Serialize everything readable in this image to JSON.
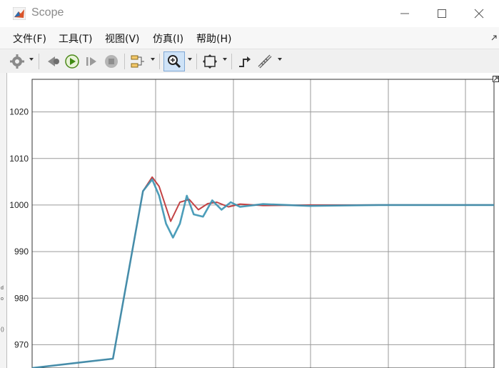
{
  "window": {
    "title": "Scope",
    "accent": "#0072bd"
  },
  "menu": {
    "items": [
      "文件(F)",
      "工具(T)",
      "视图(V)",
      "仿真(I)",
      "帮助(H)"
    ]
  },
  "toolbar": {
    "buttons": [
      "gear-icon",
      "stop-back-icon",
      "run-icon",
      "step-forward-icon",
      "stop-icon",
      "signal-select-icon",
      "zoom-in-icon",
      "autoscale-icon",
      "cursor-measure-icon",
      "triggers-icon"
    ]
  },
  "side_labels": {
    "a": "d",
    "b": "o",
    "c": "()"
  },
  "chart_data": {
    "type": "line",
    "title": "",
    "xlabel": "",
    "ylabel": "",
    "ylim": [
      965,
      1027
    ],
    "yticks": [
      970,
      980,
      990,
      1000,
      1010,
      1020
    ],
    "ytick_labels": [
      "970",
      "980",
      "990",
      "1000",
      "1010",
      "1020"
    ],
    "grid": true,
    "background": "#ffffff",
    "series": [
      {
        "color": "#c0393b",
        "x": [
          0,
          0.35,
          0.48,
          0.52,
          0.55,
          0.6,
          0.64,
          0.68,
          0.72,
          0.76,
          0.8,
          0.85,
          0.9,
          1.0,
          1.2,
          1.5,
          2.0
        ],
        "y": [
          965,
          967,
          1003,
          1006,
          1004,
          996.5,
          1000.6,
          1001.2,
          999.0,
          1000.3,
          1000.6,
          999.6,
          1000.2,
          999.9,
          1000.0,
          1000.0,
          1000.0
        ]
      },
      {
        "color": "#3a93b3",
        "x": [
          0,
          0.35,
          0.48,
          0.52,
          0.55,
          0.58,
          0.61,
          0.64,
          0.67,
          0.7,
          0.74,
          0.78,
          0.82,
          0.86,
          0.9,
          1.0,
          1.2,
          1.5,
          2.0
        ],
        "y": [
          965,
          967,
          1003,
          1005.5,
          1002,
          996,
          993,
          996,
          1002,
          998,
          997.5,
          1001,
          999,
          1000.6,
          999.6,
          1000.2,
          999.8,
          1000.0,
          1000.0
        ]
      }
    ]
  }
}
